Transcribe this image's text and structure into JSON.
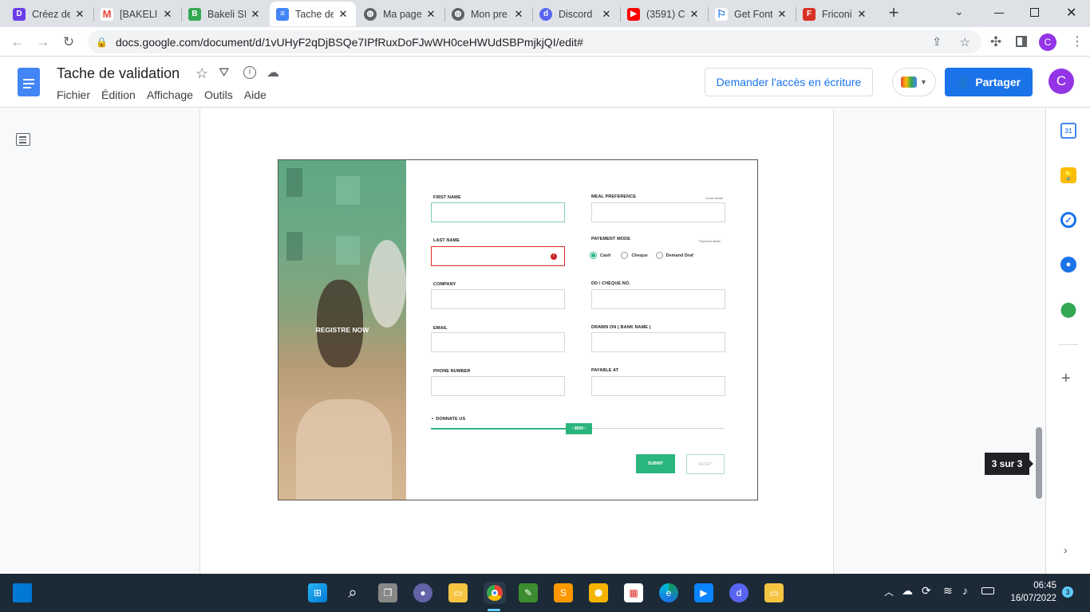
{
  "browser": {
    "tabs": [
      {
        "title": "Créez de",
        "icon": "creez-icon",
        "color": "#6a3de8"
      },
      {
        "title": "[BAKELI",
        "icon": "gmail-icon",
        "color": "#ea4335"
      },
      {
        "title": "Bakeli SI",
        "icon": "bakeli-icon",
        "color": "#34a853"
      },
      {
        "title": "Tache de",
        "icon": "docs-icon",
        "color": "#4285f4"
      },
      {
        "title": "Ma page",
        "icon": "globe-icon",
        "color": "#5f6368"
      },
      {
        "title": "Mon pre",
        "icon": "globe-icon",
        "color": "#5f6368"
      },
      {
        "title": "Discord",
        "icon": "discord-icon",
        "color": "#5865f2"
      },
      {
        "title": "(3591) C",
        "icon": "youtube-icon",
        "color": "#ff0000"
      },
      {
        "title": "Get Font",
        "icon": "flag-icon",
        "color": "#1a73e8"
      },
      {
        "title": "Friconix",
        "icon": "friconix-icon",
        "color": "#d93025"
      }
    ],
    "new_tab_label": "+",
    "url": "docs.google.com/document/d/1vUHyF2qDjBSQe7IPfRuxDoFJwWH0ceHWUdSBPmjkjQI/edit#",
    "profile_initial": "C"
  },
  "docs": {
    "title": "Tache de validation",
    "menu": [
      "Fichier",
      "Édition",
      "Affichage",
      "Outils",
      "Aide"
    ],
    "request_edit_label": "Demander l'accès en écriture",
    "share_label": "Partager",
    "avatar_initial": "C",
    "page_indicator": "3 sur 3"
  },
  "form": {
    "hero_text": "REGISTRE NOW",
    "left_fields": [
      "FIRST NAME",
      "LAST NAME",
      "COMPANY",
      "EMAIL",
      "PHONE NUMBER"
    ],
    "right_fields": [
      "MEAL PREFERENCE",
      "PAYEMENT MODE",
      "DD / CHEQUE NO.",
      "DRAWN ON ( BANK NAME )",
      "PAYABLE AT"
    ],
    "meal_hint": "Lunch detail",
    "payment_hint": "Payment detail",
    "payment_options": [
      "Cash",
      "Cheque",
      "Demand Draf"
    ],
    "donate_label": "DONNATE US",
    "donate_value": "$500",
    "submit_label": "SUBMIT",
    "reset_label": "RESET"
  },
  "taskbar": {
    "time": "06:45",
    "date": "16/07/2022",
    "notification_count": "3"
  },
  "colors": {
    "accent": "#1a73e8",
    "form_green": "#2bb57e",
    "error": "#d93025"
  }
}
